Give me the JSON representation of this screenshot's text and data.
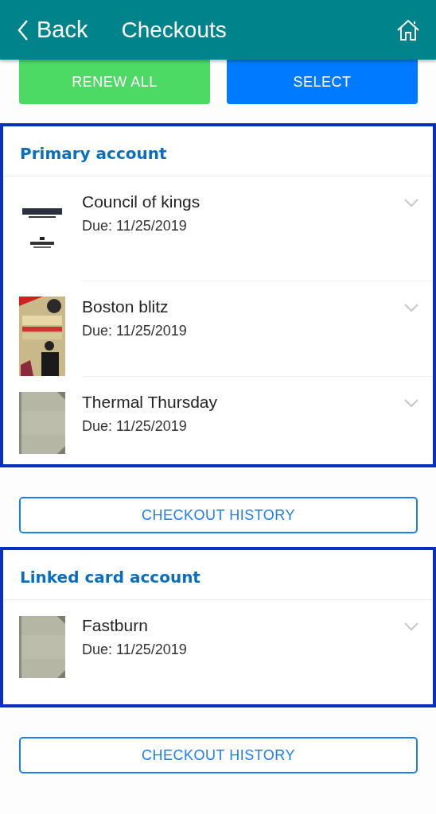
{
  "header": {
    "back_label": "Back",
    "title": "Checkouts"
  },
  "actions": [
    {
      "label": "RENEW ALL",
      "kind": "success"
    },
    {
      "label": "SELECT",
      "kind": "primary"
    }
  ],
  "accounts": [
    {
      "title": "Primary account",
      "history_button": "CHECKOUT HISTORY",
      "items": [
        {
          "title": "Council of kings",
          "due": "Due: 11/25/2019"
        },
        {
          "title": "Boston blitz",
          "due": "Due: 11/25/2019"
        },
        {
          "title": "Thermal Thursday",
          "due": "Due: 11/25/2019"
        }
      ]
    },
    {
      "title": "Linked card account",
      "history_button": "CHECKOUT HISTORY",
      "items": [
        {
          "title": "Fastburn",
          "due": "Due: 11/25/2019"
        }
      ]
    }
  ]
}
